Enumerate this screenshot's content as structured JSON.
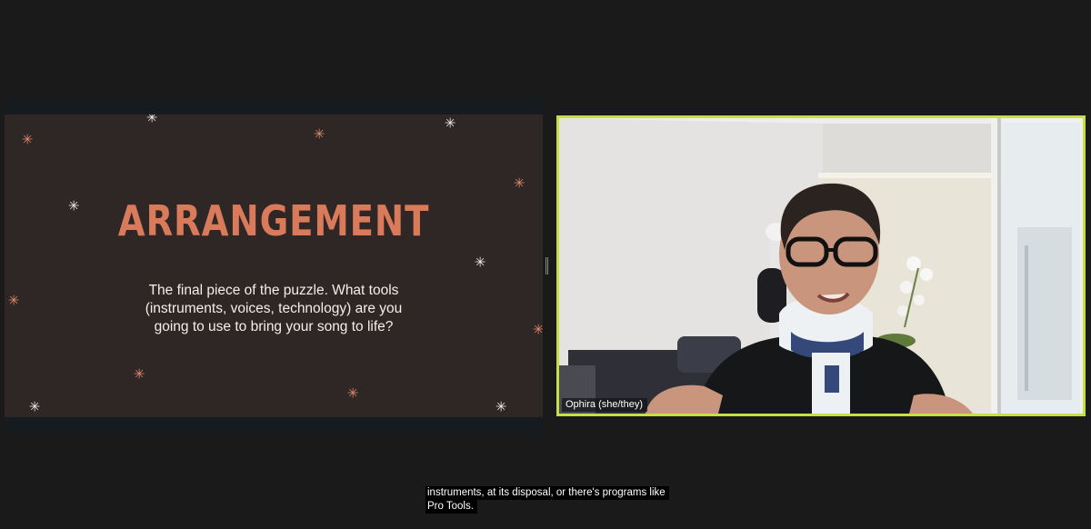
{
  "slide": {
    "title": "ARRANGEMENT",
    "body": "The final piece of the puzzle. What tools (instruments, voices, technology) are you going to use to bring your song to life?",
    "colors": {
      "background": "#2f2626",
      "title": "#d97a5b",
      "star_orange": "#e08a6c",
      "star_white": "#f2eeea"
    }
  },
  "video": {
    "participant_name": "Ophira (she/they)",
    "active_speaker_border": "#c6df45"
  },
  "captions": {
    "line1": "instruments, at its disposal, or there's programs like",
    "line2": "Pro Tools."
  }
}
